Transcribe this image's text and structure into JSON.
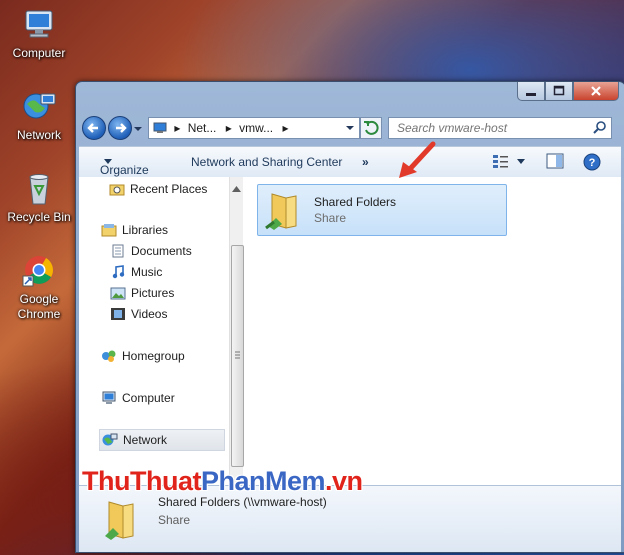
{
  "desktop": {
    "icons": [
      {
        "label": "Computer",
        "icon": "computer-icon"
      },
      {
        "label": "Network",
        "icon": "network-icon"
      },
      {
        "label": "Recycle Bin",
        "icon": "recycle-bin-icon"
      },
      {
        "label_line1": "Google",
        "label_line2": "Chrome",
        "icon": "chrome-icon"
      }
    ]
  },
  "window": {
    "address": {
      "seg1": "Net...",
      "seg2": "vmw...",
      "sep": "▸"
    },
    "search": {
      "placeholder": "Search vmware-host"
    },
    "toolbar": {
      "organize": "Organize",
      "network_center": "Network and Sharing Center",
      "more": "»"
    },
    "nav": {
      "recent_places": "Recent Places",
      "libraries": "Libraries",
      "documents": "Documents",
      "music": "Music",
      "pictures": "Pictures",
      "videos": "Videos",
      "homegroup": "Homegroup",
      "computer": "Computer",
      "network": "Network"
    },
    "item": {
      "name": "Shared Folders",
      "type": "Share"
    },
    "details": {
      "name": "Shared Folders (\\\\vmware-host)",
      "type": "Share"
    }
  },
  "watermark": {
    "part1": "ThuThuat",
    "part2": "PhanMem",
    "part3": ".vn"
  },
  "colors": {
    "selection": "#c7e1fa",
    "arrow": "#e23a2a",
    "accent": "#1f5fb8"
  }
}
